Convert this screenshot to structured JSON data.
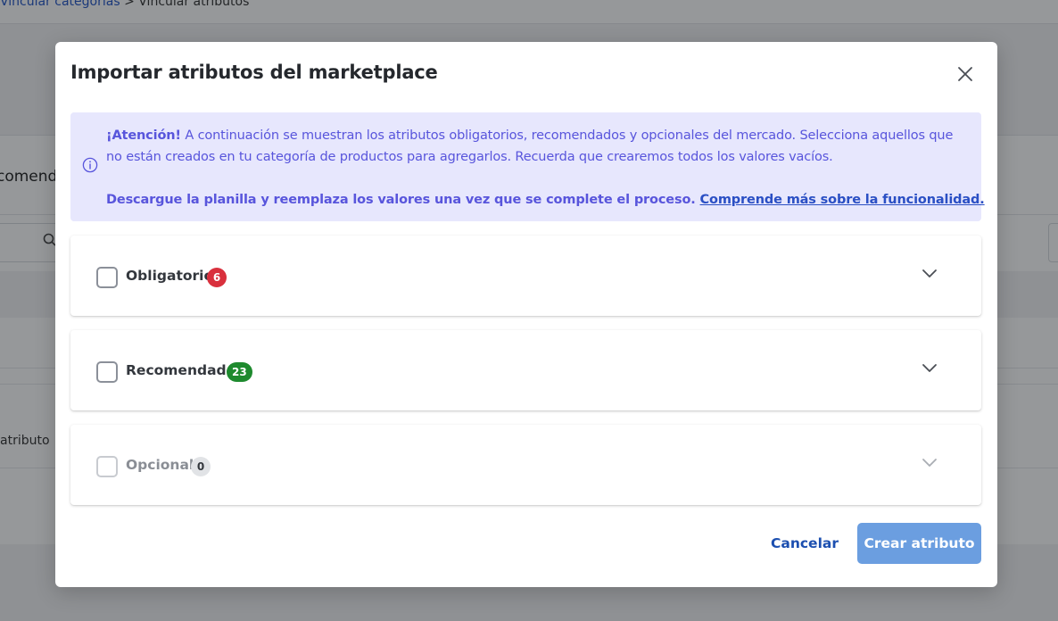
{
  "background": {
    "breadcrumb_link": "Vincular categorías",
    "breadcrumb_separator": ">",
    "breadcrumb_current": "Vincular atributos",
    "tab_fragment": "comend",
    "cell_fragment": "atributo"
  },
  "modal": {
    "title": "Importar atributos del marketplace",
    "close_icon": "close-icon"
  },
  "alert": {
    "icon": "info-icon",
    "bold_prefix": "¡Atención!",
    "line1_rest": " A continuación se muestran los atributos obligatorios, recomendados y opcionales del mercado. Selecciona aquellos que",
    "line2": "no están creados en tu categoría de productos para agregarlos. Recuerda que crearemos todos los valores vacíos.",
    "line3": "Descargue la planilla y reemplaza los valores una vez que se complete el proceso. ",
    "link": "Comprende más sobre la funcionalidad.",
    "background_color": "#e7e7fd",
    "text_color": "#5855dc"
  },
  "sections": [
    {
      "label": "Obligatorio",
      "count": "6",
      "badge_color": "#d9303d",
      "checked": false,
      "disabled": false
    },
    {
      "label": "Recomendado",
      "count": "23",
      "badge_color": "#1e8a2e",
      "checked": false,
      "disabled": false
    },
    {
      "label": "Opcional",
      "count": "0",
      "badge_color": "#e1e3e6",
      "checked": false,
      "disabled": true
    }
  ],
  "footer": {
    "cancel_label": "Cancelar",
    "create_label": "Crear atributo",
    "create_color": "#6b9ee0"
  }
}
